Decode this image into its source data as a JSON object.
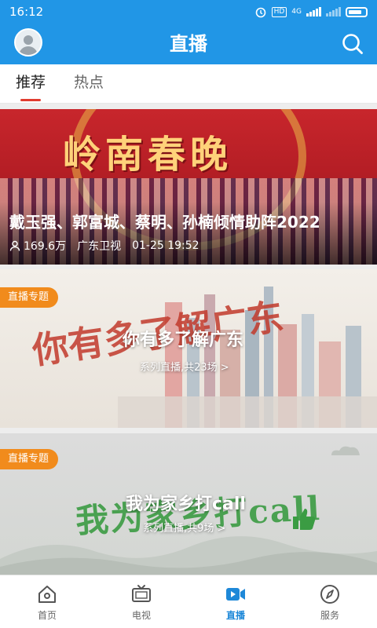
{
  "status_bar": {
    "time": "16:12",
    "network": "4G",
    "hd": "HD"
  },
  "header": {
    "title": "直播"
  },
  "tabs": [
    {
      "label": "推荐",
      "active": true
    },
    {
      "label": "热点",
      "active": false
    }
  ],
  "feed": {
    "featured": {
      "banner_text": "岭南春晚",
      "headline": "戴玉强、郭富城、蔡明、孙楠倾情助阵2022",
      "views": "169.6万",
      "channel": "广东卫视",
      "datetime": "01-25 19:52"
    },
    "topics": [
      {
        "badge": "直播专题",
        "art_text": "你有多了解广东",
        "title": "你有多了解广东",
        "subtitle": "系列直播,共23场 >"
      },
      {
        "badge": "直播专题",
        "art_text": "我为家乡打call",
        "title": "我为家乡打call",
        "subtitle": "系列直播,共9场 >"
      }
    ]
  },
  "bottom_nav": [
    {
      "label": "首页",
      "icon": "home-icon",
      "active": false
    },
    {
      "label": "电视",
      "icon": "tv-icon",
      "active": false
    },
    {
      "label": "直播",
      "icon": "video-icon",
      "active": true
    },
    {
      "label": "服务",
      "icon": "compass-icon",
      "active": false
    }
  ],
  "colors": {
    "primary": "#2196e6",
    "accent_red": "#e03c2f",
    "badge_orange": "#f18b1c",
    "nav_active": "#1e88d8"
  }
}
